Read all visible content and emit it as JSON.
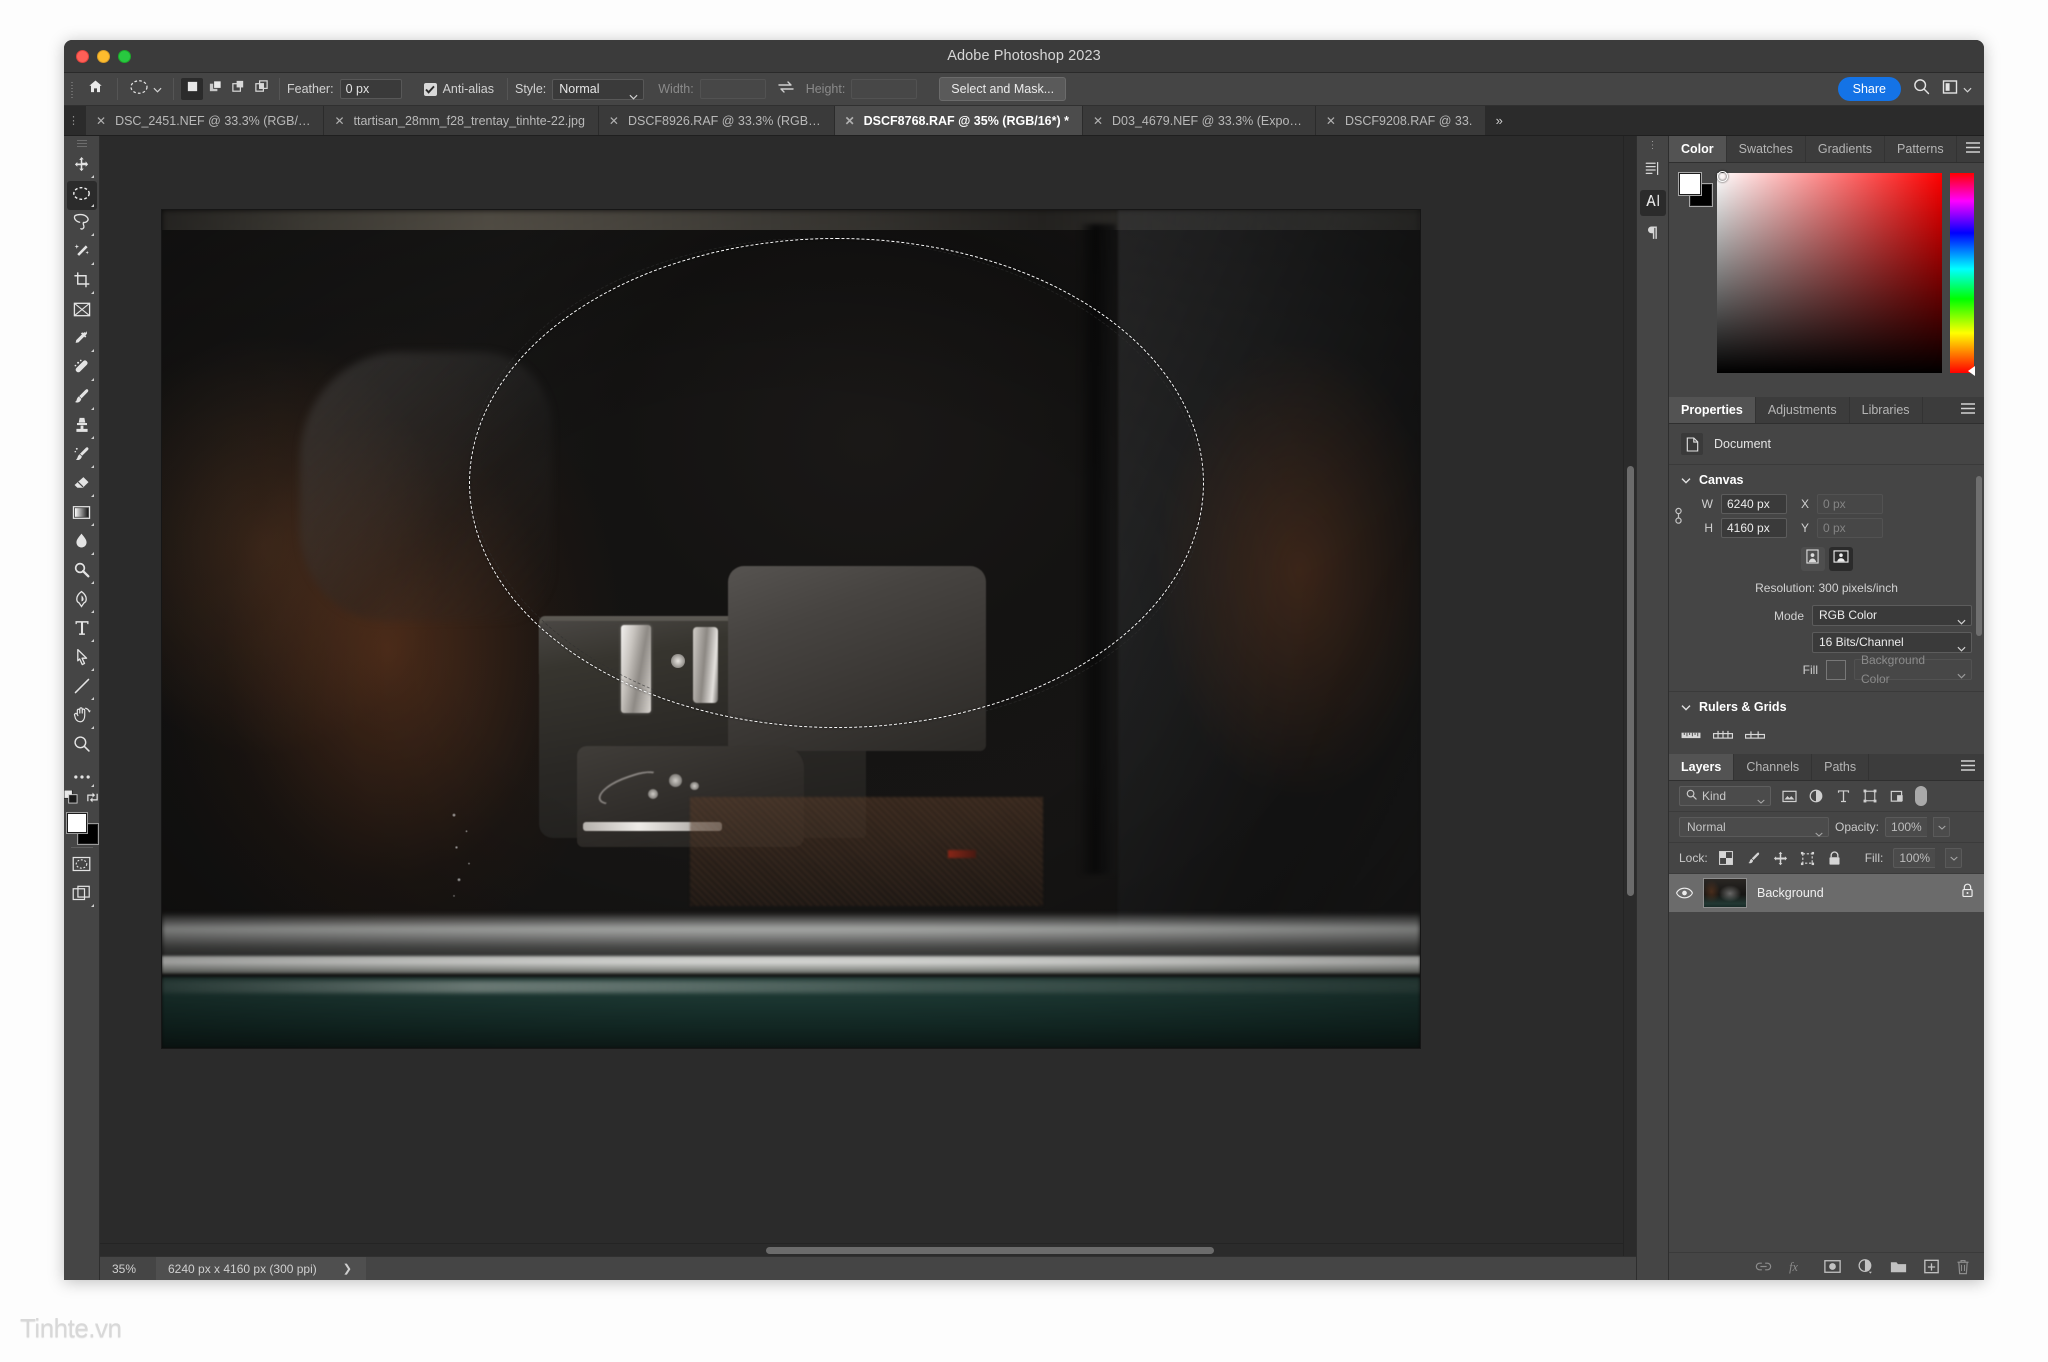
{
  "window": {
    "title": "Adobe Photoshop 2023",
    "traffic_lights": [
      "close",
      "minimize",
      "zoom"
    ]
  },
  "options_bar": {
    "home_icon": "home-icon",
    "tool_preset_icon": "elliptical-marquee-icon",
    "tool_preset_chevron": "chevron-down-icon",
    "selection_modes": [
      {
        "name": "new-selection",
        "icon": "square-filled-icon",
        "active": true
      },
      {
        "name": "add-to-selection",
        "icon": "add-selection-icon",
        "active": false
      },
      {
        "name": "subtract-from-selection",
        "icon": "subtract-selection-icon",
        "active": false
      },
      {
        "name": "intersect-with-selection",
        "icon": "intersect-selection-icon",
        "active": false
      }
    ],
    "feather_label": "Feather:",
    "feather_value": "0 px",
    "antialias_label": "Anti-alias",
    "antialias_checked": true,
    "style_label": "Style:",
    "style_value": "Normal",
    "width_label": "Width:",
    "width_value": "",
    "swap_icon": "swap-arrows-icon",
    "height_label": "Height:",
    "height_value": "",
    "select_and_mask_label": "Select and Mask...",
    "share_label": "Share",
    "search_icon": "search-icon",
    "workspace_icon": "workspace-icon",
    "workspace_chevron": "chevron-down-icon"
  },
  "tabs": {
    "overflow_icon": "double-chevron-right-icon",
    "items": [
      {
        "label": "DSC_2451.NEF @ 33.3% (RGB/…",
        "active": false
      },
      {
        "label": "ttartisan_28mm_f28_trentay_tinhte-22.jpg",
        "active": false
      },
      {
        "label": "DSCF8926.RAF @ 33.3% (RGB…",
        "active": false
      },
      {
        "label": "DSCF8768.RAF @ 35% (RGB/16*) *",
        "active": true
      },
      {
        "label": "D03_4679.NEF @ 33.3% (Expo…",
        "active": false
      },
      {
        "label": "DSCF9208.RAF @ 33.",
        "active": false
      }
    ]
  },
  "toolbar": {
    "tools": [
      {
        "name": "move-tool",
        "icon": "move-icon",
        "active": false
      },
      {
        "name": "elliptical-marquee-tool",
        "icon": "ellipse-marquee-icon",
        "active": true
      },
      {
        "name": "lasso-tool",
        "icon": "lasso-icon",
        "active": false
      },
      {
        "name": "object-selection-tool",
        "icon": "magic-wand-icon",
        "active": false
      },
      {
        "name": "crop-tool",
        "icon": "crop-icon",
        "active": false
      },
      {
        "name": "frame-tool",
        "icon": "frame-icon",
        "active": false
      },
      {
        "name": "eyedropper-tool",
        "icon": "eyedropper-icon",
        "active": false
      },
      {
        "name": "spot-healing-brush-tool",
        "icon": "healing-brush-icon",
        "active": false
      },
      {
        "name": "brush-tool",
        "icon": "brush-icon",
        "active": false
      },
      {
        "name": "clone-stamp-tool",
        "icon": "stamp-icon",
        "active": false
      },
      {
        "name": "history-brush-tool",
        "icon": "history-brush-icon",
        "active": false
      },
      {
        "name": "eraser-tool",
        "icon": "eraser-icon",
        "active": false
      },
      {
        "name": "gradient-tool",
        "icon": "gradient-icon",
        "active": false
      },
      {
        "name": "blur-tool",
        "icon": "blur-droplet-icon",
        "active": false
      },
      {
        "name": "dodge-tool",
        "icon": "dodge-icon",
        "active": false
      },
      {
        "name": "pen-tool",
        "icon": "pen-icon",
        "active": false
      },
      {
        "name": "type-tool",
        "icon": "type-t-icon",
        "active": false
      },
      {
        "name": "path-selection-tool",
        "icon": "path-arrow-icon",
        "active": false
      },
      {
        "name": "line-tool",
        "icon": "line-icon",
        "active": false
      },
      {
        "name": "hand-tool",
        "icon": "hand-rotate-icon",
        "active": false
      },
      {
        "name": "zoom-tool",
        "icon": "magnifier-icon",
        "active": false
      },
      {
        "name": "edit-toolbar",
        "icon": "ellipsis-icon",
        "active": false
      }
    ],
    "default_colors_icon": "default-colors-icon",
    "swap_colors_icon": "swap-colors-icon",
    "foreground_color": "#ffffff",
    "background_color": "#000000",
    "quick_mask_icon": "quick-mask-icon",
    "screen_mode_icon": "screen-mode-icon"
  },
  "canvas": {
    "selection": {
      "shape": "ellipse",
      "style": "marching-ants"
    },
    "image_subject": "car interior through window",
    "scroll_vertical": "visible",
    "scroll_horizontal": "visible"
  },
  "status_bar": {
    "zoom": "35%",
    "doc_info": "6240 px x 4160 px (300 ppi)",
    "expand_icon": "chevron-right-icon"
  },
  "right_rail": {
    "items": [
      {
        "name": "history-panel-icon",
        "icon": "history-icon",
        "active": false
      },
      {
        "name": "character-panel-icon",
        "icon": "character-A-icon",
        "active": true
      },
      {
        "name": "paragraph-panel-icon",
        "icon": "paragraph-pilcrow-icon",
        "active": false
      }
    ]
  },
  "color_panel": {
    "tabs": [
      {
        "label": "Color",
        "active": true
      },
      {
        "label": "Swatches",
        "active": false
      },
      {
        "label": "Gradients",
        "active": false
      },
      {
        "label": "Patterns",
        "active": false
      }
    ],
    "menu_icon": "hamburger-menu-icon",
    "foreground": "#ffffff",
    "background": "#000000",
    "spectrum_base_hue": "#ff0000"
  },
  "properties_panel": {
    "tabs": [
      {
        "label": "Properties",
        "active": true
      },
      {
        "label": "Adjustments",
        "active": false
      },
      {
        "label": "Libraries",
        "active": false
      }
    ],
    "menu_icon": "hamburger-menu-icon",
    "document_icon": "document-icon",
    "document_label": "Document",
    "canvas_section": {
      "title": "Canvas",
      "disclosure_icon": "chevron-down-icon",
      "link_icon": "link-constrain-icon",
      "w_label": "W",
      "w_value": "6240 px",
      "h_label": "H",
      "h_value": "4160 px",
      "x_label": "X",
      "x_placeholder": "0 px",
      "y_label": "Y",
      "y_placeholder": "0 px",
      "orientation": [
        {
          "name": "portrait-orientation",
          "icon": "portrait-icon",
          "active": false
        },
        {
          "name": "landscape-orientation",
          "icon": "landscape-icon",
          "active": true
        }
      ],
      "resolution_label": "Resolution: 300 pixels/inch",
      "mode_label": "Mode",
      "mode_value": "RGB Color",
      "depth_value": "16 Bits/Channel",
      "fill_label": "Fill",
      "fill_swatch": "#474747",
      "fill_value": "Background Color"
    },
    "rulers_section": {
      "title": "Rulers & Grids",
      "disclosure_icon": "chevron-down-icon",
      "icons": [
        "ruler-icon",
        "grid-icon",
        "guides-icon"
      ]
    }
  },
  "layers_panel": {
    "tabs": [
      {
        "label": "Layers",
        "active": true
      },
      {
        "label": "Channels",
        "active": false
      },
      {
        "label": "Paths",
        "active": false
      }
    ],
    "menu_icon": "hamburger-menu-icon",
    "filter": {
      "kind_label": "Kind",
      "search_icon": "search-icon",
      "chevron_icon": "chevron-down-icon",
      "filter_icons": [
        "filter-pixel-icon",
        "filter-adjustment-icon",
        "filter-type-icon",
        "filter-shape-icon",
        "filter-smart-object-icon"
      ],
      "toggle_icon": "filter-toggle-icon"
    },
    "blend_mode": "Normal",
    "blend_chevron": "chevron-down-icon",
    "opacity_label": "Opacity:",
    "opacity_value": "100%",
    "lock_label": "Lock:",
    "lock_icons": [
      "lock-transparent-pixels-icon",
      "lock-image-pixels-icon",
      "lock-position-icon",
      "lock-artboard-nesting-icon",
      "lock-all-icon"
    ],
    "fill_label": "Fill:",
    "fill_value": "100%",
    "layers": [
      {
        "name": "Background",
        "visible": true,
        "locked": true,
        "eye_icon": "eye-icon",
        "lock_icon": "lock-icon",
        "selected": true
      }
    ],
    "bottom_icons": [
      {
        "name": "link-layers-icon",
        "glyph": "link",
        "dim": true
      },
      {
        "name": "layer-styles-fx-icon",
        "glyph": "fx",
        "dim": true
      },
      {
        "name": "add-layer-mask-icon",
        "glyph": "mask",
        "dim": false
      },
      {
        "name": "new-adjustment-layer-icon",
        "glyph": "half-circle",
        "dim": false
      },
      {
        "name": "new-group-icon",
        "glyph": "folder",
        "dim": false
      },
      {
        "name": "new-layer-icon",
        "glyph": "plus-square",
        "dim": false
      },
      {
        "name": "delete-layer-icon",
        "glyph": "trash",
        "dim": true
      }
    ]
  },
  "watermark": {
    "text": "Tinhte.vn"
  },
  "colors": {
    "accent_blue": "#1473e6",
    "panel_bg": "#454545",
    "canvas_bg": "#2b2b2b",
    "titlebar_bg": "#3b3b3b",
    "tab_active_bg": "#4c4c4c"
  }
}
